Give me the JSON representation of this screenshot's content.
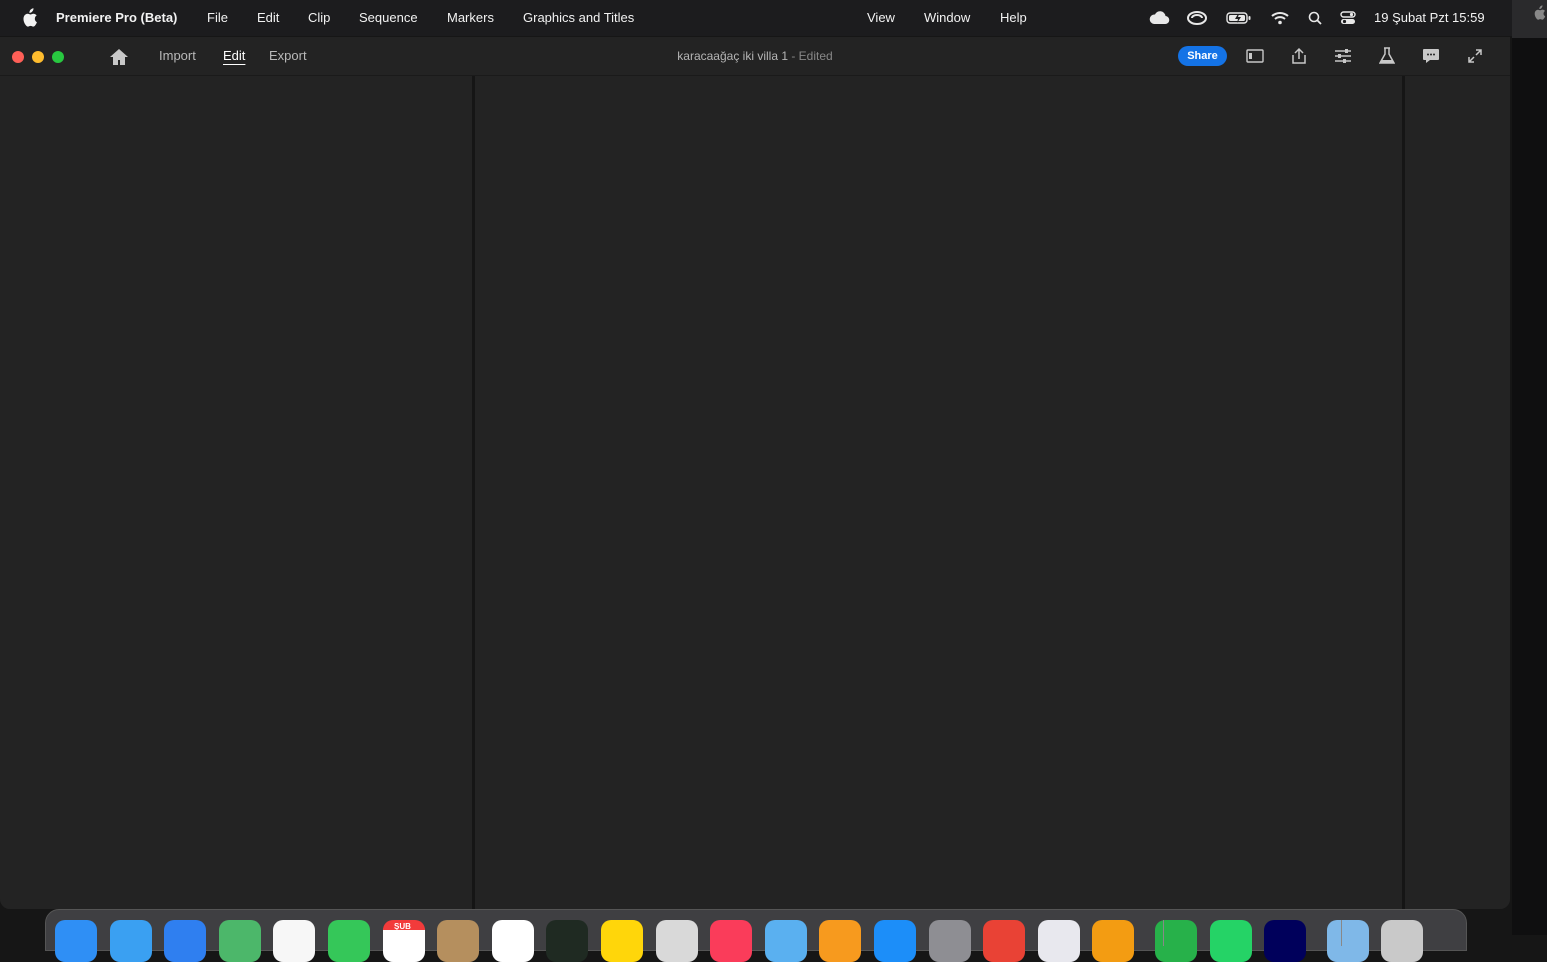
{
  "menubar": {
    "app_name": "Premiere Pro (Beta)",
    "items": [
      "File",
      "Edit",
      "Clip",
      "Sequence",
      "Markers",
      "Graphics and Titles",
      "View",
      "Window",
      "Help"
    ],
    "clock": "19 Şubat Pzt  15:59"
  },
  "window": {
    "tabs": [
      "Import",
      "Edit",
      "Export"
    ],
    "active_tab": "Edit",
    "doc_title": "karacaağaç iki villa 1",
    "doc_status": "- Edited",
    "share_label": "Share"
  },
  "colors": {
    "accent": "#1473e6",
    "close": "#fe5f57",
    "minimize": "#febc2e",
    "maximize": "#28c840",
    "panel_bg": "#232323"
  },
  "dock": {
    "calendar_month": "ŞUB",
    "apps": [
      {
        "icon": "finder-icon",
        "color": "#2f8ff5"
      },
      {
        "icon": "safari-icon",
        "color": "#3aa0f2"
      },
      {
        "icon": "mail-icon",
        "color": "#2f7ff0"
      },
      {
        "icon": "maps-icon",
        "color": "#4cb76a"
      },
      {
        "icon": "photos-icon",
        "color": "#f7f7f7"
      },
      {
        "icon": "facetime-icon",
        "color": "#35c759"
      },
      {
        "icon": "calendar-icon",
        "color": "#ffffff"
      },
      {
        "icon": "contacts-icon",
        "color": "#b58f5e"
      },
      {
        "icon": "reminders-icon",
        "color": "#ffffff"
      },
      {
        "icon": "terminal-icon",
        "color": "#1f2a22"
      },
      {
        "icon": "notes-icon",
        "color": "#ffd60a"
      },
      {
        "icon": "launchpad-icon",
        "color": "#d9d9d9"
      },
      {
        "icon": "music-icon",
        "color": "#fa3c5a"
      },
      {
        "icon": "preview-icon",
        "color": "#5ab0f0"
      },
      {
        "icon": "pages-icon",
        "color": "#f79a1e"
      },
      {
        "icon": "appstore-icon",
        "color": "#1c8ef9"
      },
      {
        "icon": "system-settings-icon",
        "color": "#8e8e93"
      },
      {
        "icon": "chrome-icon",
        "color": "#e94235"
      },
      {
        "icon": "preview-photo-icon",
        "color": "#e8e8ee"
      },
      {
        "icon": "keynote-icon",
        "color": "#f39c12"
      },
      {
        "icon": "numbers-icon",
        "color": "#27b14a"
      },
      {
        "icon": "whatsapp-icon",
        "color": "#25d366"
      },
      {
        "icon": "premiere-icon",
        "color": "#00005b"
      },
      {
        "icon": "downloads-folder-icon",
        "color": "#7fb8e8"
      },
      {
        "icon": "trash-icon",
        "color": "#c9c9c9"
      }
    ]
  }
}
